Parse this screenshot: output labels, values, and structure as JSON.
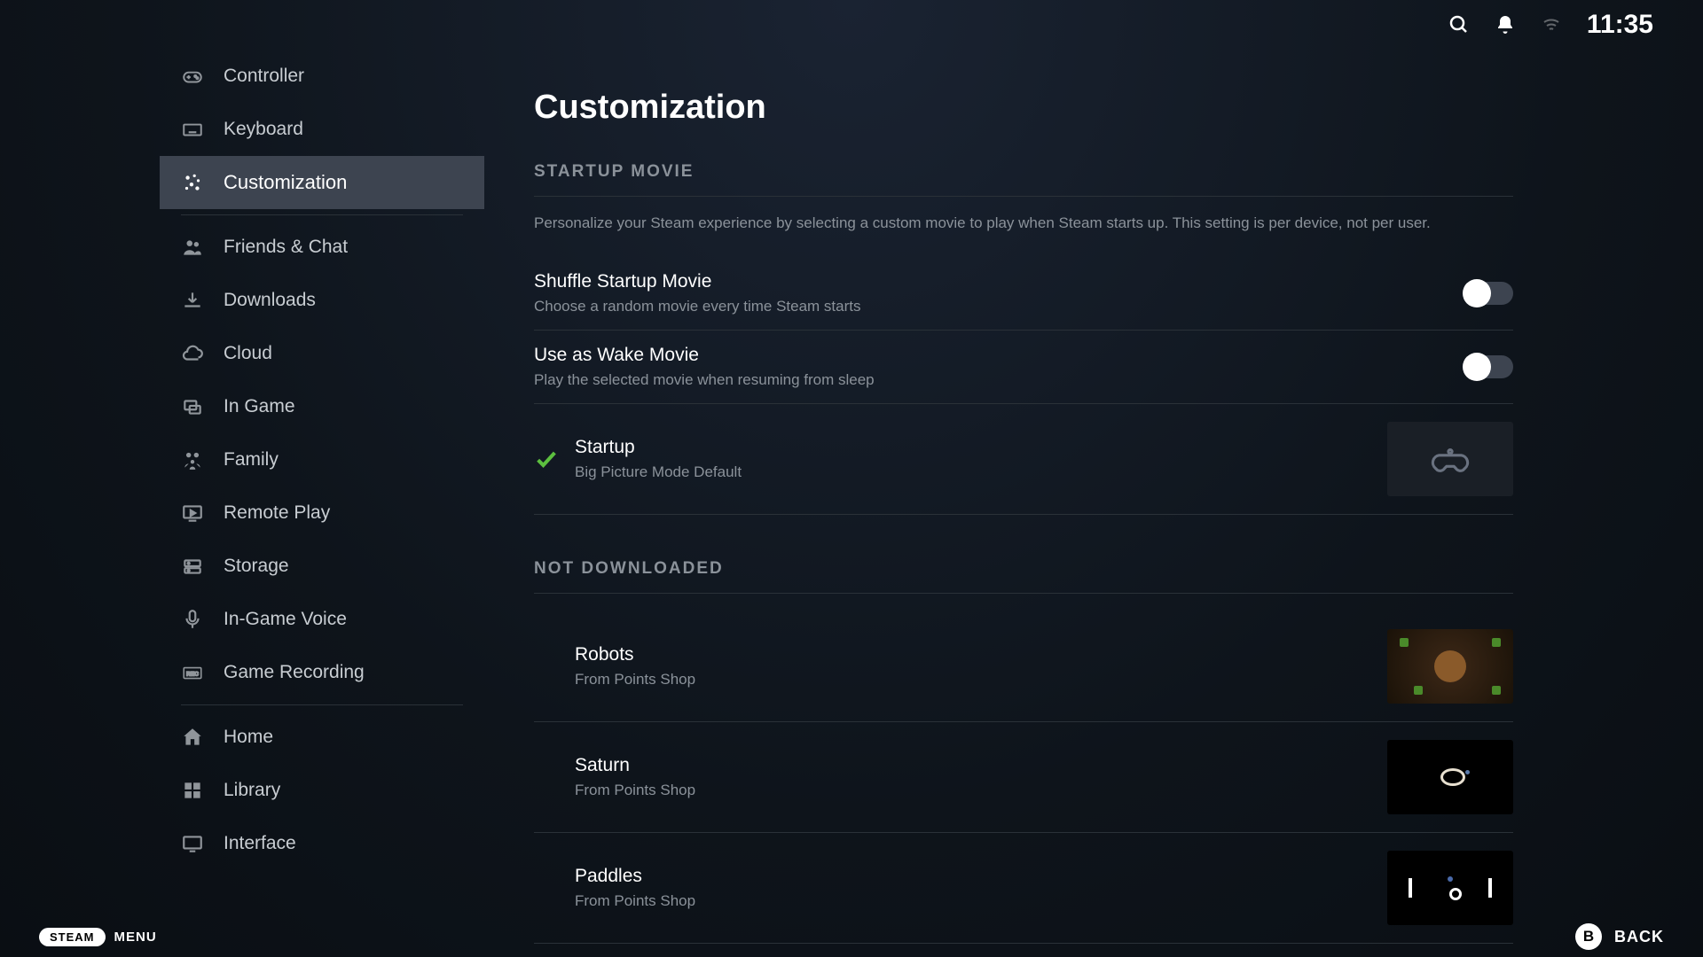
{
  "topbar": {
    "clock": "11:35"
  },
  "sidebar": {
    "items": [
      {
        "label": "Controller",
        "icon": "gamepad"
      },
      {
        "label": "Keyboard",
        "icon": "keyboard"
      },
      {
        "label": "Customization",
        "icon": "customize",
        "active": true
      },
      {
        "divider": true
      },
      {
        "label": "Friends & Chat",
        "icon": "friends"
      },
      {
        "label": "Downloads",
        "icon": "download"
      },
      {
        "label": "Cloud",
        "icon": "cloud"
      },
      {
        "label": "In Game",
        "icon": "overlay"
      },
      {
        "label": "Family",
        "icon": "family"
      },
      {
        "label": "Remote Play",
        "icon": "remote"
      },
      {
        "label": "Storage",
        "icon": "storage"
      },
      {
        "label": "In-Game Voice",
        "icon": "mic"
      },
      {
        "label": "Game Recording",
        "icon": "rec"
      },
      {
        "divider": true
      },
      {
        "label": "Home",
        "icon": "home"
      },
      {
        "label": "Library",
        "icon": "library"
      },
      {
        "label": "Interface",
        "icon": "interface"
      }
    ]
  },
  "main": {
    "title": "Customization",
    "startup_section": {
      "header": "STARTUP MOVIE",
      "description": "Personalize your Steam experience by selecting a custom movie to play when Steam starts up. This setting is per device, not per user.",
      "shuffle": {
        "title": "Shuffle Startup Movie",
        "subtitle": "Choose a random movie every time Steam starts",
        "enabled": false
      },
      "wake": {
        "title": "Use as Wake Movie",
        "subtitle": "Play the selected movie when resuming from sleep",
        "enabled": false
      },
      "selected": {
        "title": "Startup",
        "subtitle": "Big Picture Mode Default"
      }
    },
    "not_downloaded_section": {
      "header": "NOT DOWNLOADED",
      "items": [
        {
          "title": "Robots",
          "subtitle": "From Points Shop",
          "thumb": "robots"
        },
        {
          "title": "Saturn",
          "subtitle": "From Points Shop",
          "thumb": "saturn"
        },
        {
          "title": "Paddles",
          "subtitle": "From Points Shop",
          "thumb": "paddles"
        }
      ]
    }
  },
  "bottombar": {
    "steam": "STEAM",
    "menu": "MENU",
    "back_button": "B",
    "back_label": "BACK"
  }
}
